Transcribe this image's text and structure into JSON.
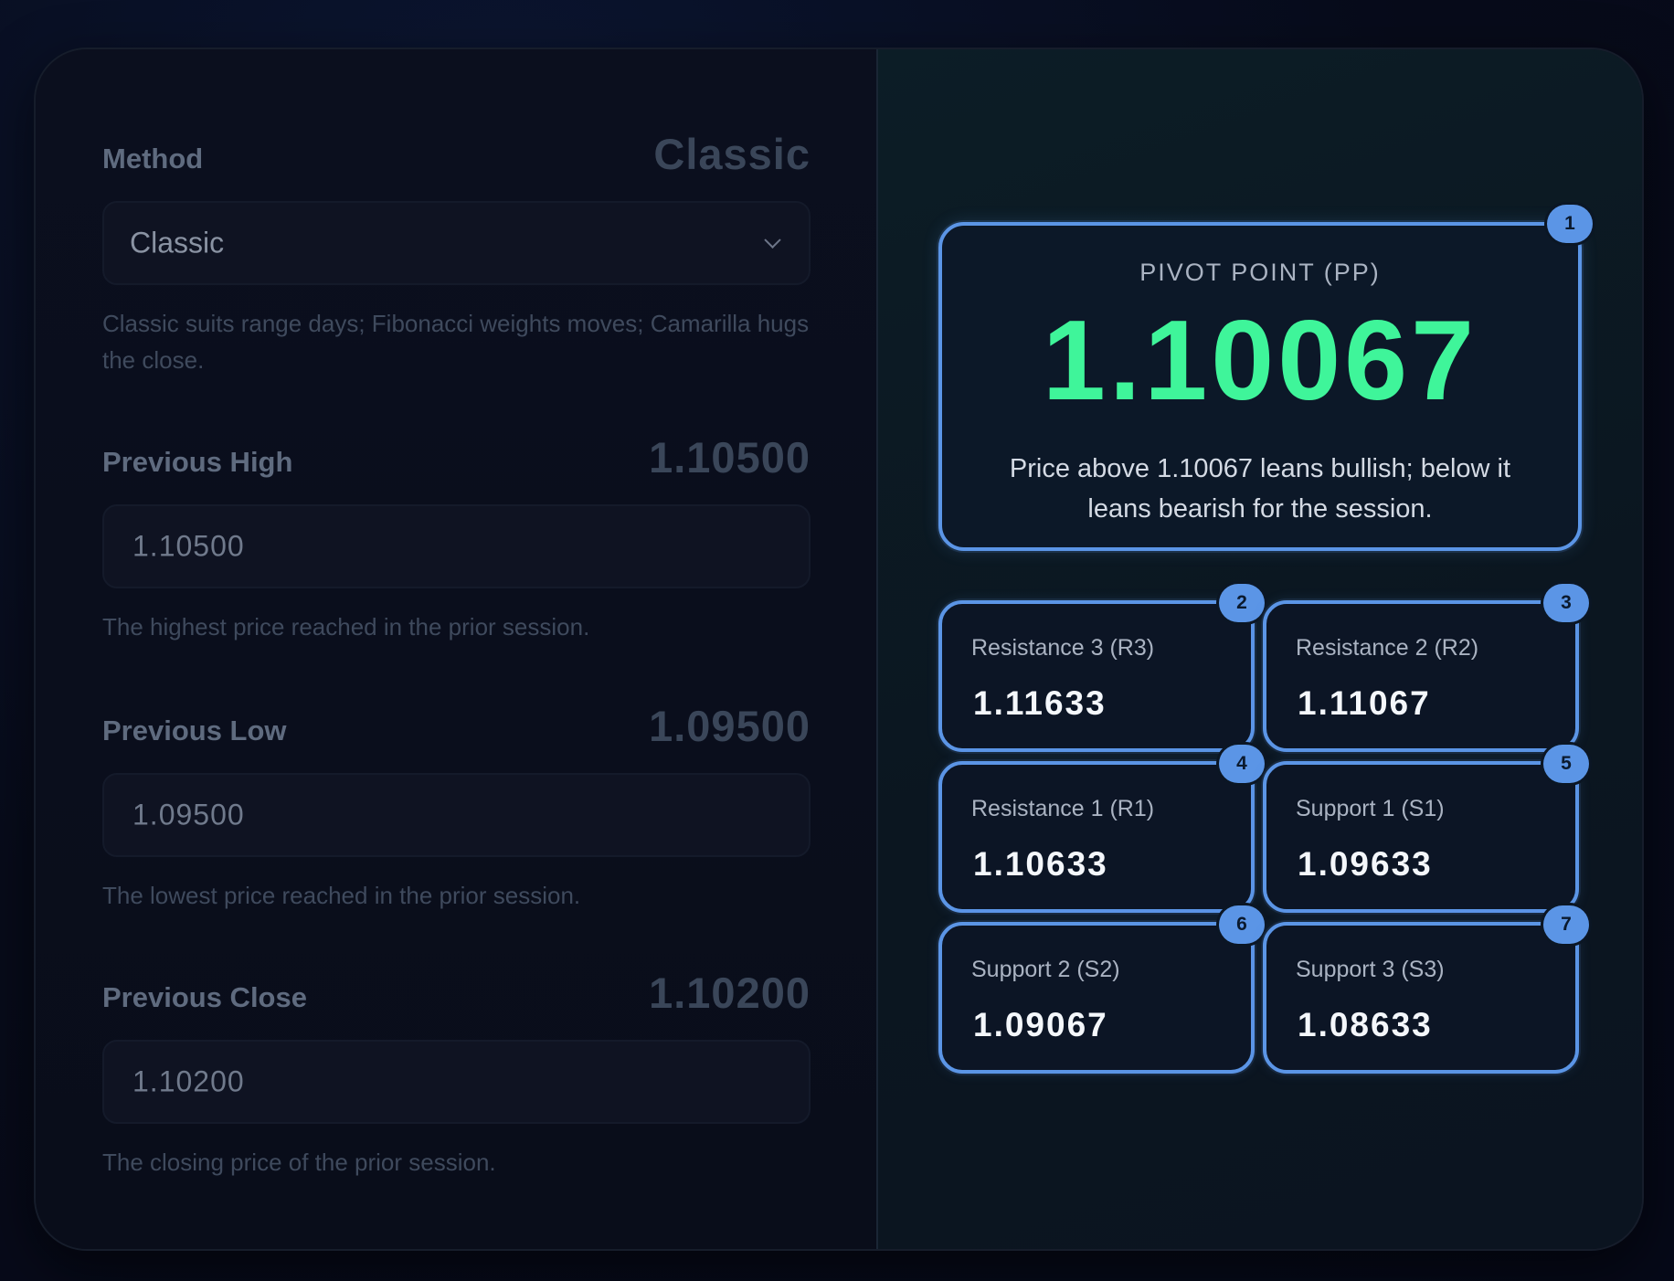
{
  "form": {
    "method": {
      "label": "Method",
      "value": "Classic",
      "selected": "Classic",
      "help": "Classic suits range days; Fibonacci weights moves; Camarilla hugs the close."
    },
    "previous_high": {
      "label": "Previous High",
      "value": "1.10500",
      "input_value": "1.10500",
      "help": "The highest price reached in the prior session."
    },
    "previous_low": {
      "label": "Previous Low",
      "value": "1.09500",
      "input_value": "1.09500",
      "help": "The lowest price reached in the prior session."
    },
    "previous_close": {
      "label": "Previous Close",
      "value": "1.10200",
      "input_value": "1.10200",
      "help": "The closing price of the prior session."
    }
  },
  "results": {
    "pivot": {
      "badge": "1",
      "title": "PIVOT POINT (PP)",
      "value": "1.10067",
      "description": "Price above 1.10067 leans bullish; below it leans bearish for the session."
    },
    "levels": [
      {
        "badge": "2",
        "label": "Resistance 3 (R3)",
        "value": "1.11633"
      },
      {
        "badge": "3",
        "label": "Resistance 2 (R2)",
        "value": "1.11067"
      },
      {
        "badge": "4",
        "label": "Resistance 1 (R1)",
        "value": "1.10633"
      },
      {
        "badge": "5",
        "label": "Support 1 (S1)",
        "value": "1.09633"
      },
      {
        "badge": "6",
        "label": "Support 2 (S2)",
        "value": "1.09067"
      },
      {
        "badge": "7",
        "label": "Support 3 (S3)",
        "value": "1.08633"
      }
    ]
  },
  "colors": {
    "accent": "#5b95e6",
    "pivot_value": "#3ff59a"
  }
}
